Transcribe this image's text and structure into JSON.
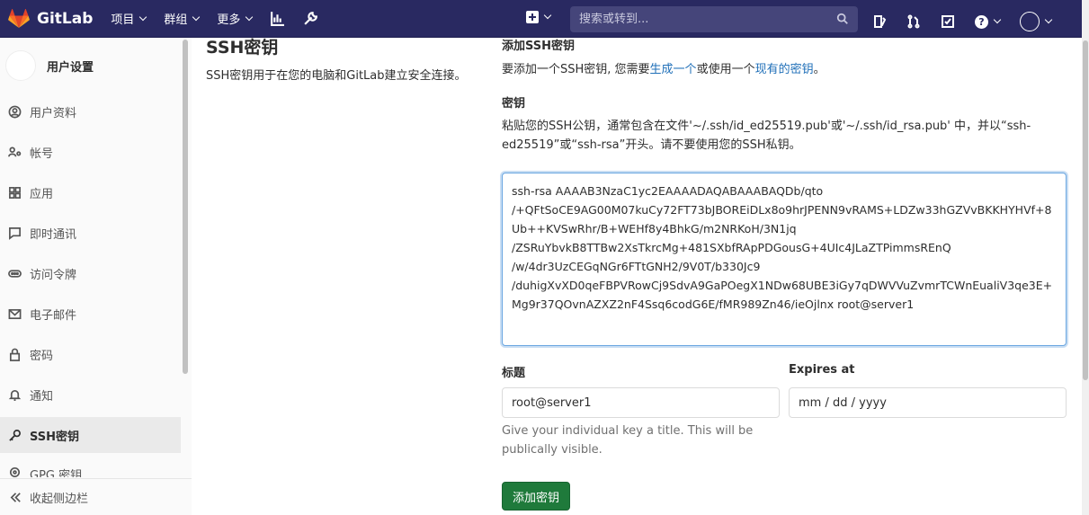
{
  "navbar": {
    "brand": "GitLab",
    "menus": [
      "项目",
      "群组",
      "更多"
    ],
    "search_placeholder": "搜索或转到..."
  },
  "sidebar": {
    "title": "用户设置",
    "items": [
      {
        "label": "用户资料",
        "icon": "user-icon"
      },
      {
        "label": "帐号",
        "icon": "account-icon"
      },
      {
        "label": "应用",
        "icon": "applications-icon"
      },
      {
        "label": "即时通讯",
        "icon": "chat-icon"
      },
      {
        "label": "访问令牌",
        "icon": "token-icon"
      },
      {
        "label": "电子邮件",
        "icon": "mail-icon"
      },
      {
        "label": "密码",
        "icon": "lock-icon"
      },
      {
        "label": "通知",
        "icon": "bell-icon"
      },
      {
        "label": "SSH密钥",
        "icon": "key-icon"
      },
      {
        "label": "GPG 密钥",
        "icon": "gpg-key-icon"
      }
    ],
    "collapse_label": "收起侧边栏"
  },
  "main": {
    "title": "SSH密钥",
    "description": "SSH密钥用于在您的电脑和GitLab建立安全连接。",
    "add_heading": "添加SSH密钥",
    "add_text_before": "要添加一个SSH密钥, 您需要",
    "add_link_generate": "生成一个",
    "add_text_middle": "或使用一个",
    "add_link_existing": "现有的密钥",
    "add_text_after": "。",
    "key_heading": "密钥",
    "key_instruction": "粘贴您的SSH公钥，通常包含在文件'~/.ssh/id_ed25519.pub'或'~/.ssh/id_rsa.pub' 中，并以“ssh-ed25519”或“ssh-rsa”开头。请不要使用您的SSH私钥。",
    "key_value": "ssh-rsa AAAAB3NzaC1yc2EAAAADAQABAAABAQDb/qto\n/+QFtSoCE9AG00M07kuCy72FT73bJBOREiDLx8o9hrJPENN9vRAMS+LDZw33hGZVvBKKHYHVf+8Ub++KVSwRhr/B+WEHf8y4BhkG/m2NRKoH/3N1jq\n/ZSRuYbvkB8TTBw2XsTkrcMg+481SXbfRApPDGousG+4UIc4JLaZTPimmsREnQ\n/w/4dr3UzCEGqNGr6FTtGNH2/9V0T/b330Jc9\n/duhigXvXD0qeFBPVRowCj9SdvA9GaPOegX1NDw68UBE3iGy7qDWVVuZvmrTCWnEualiV3qe3E+Mg9r37QOvnAZXZ2nF4Ssq6codG6E/fMR989Zn46/ieOjlnx root@server1\n",
    "title_label": "标题",
    "title_value": "root@server1",
    "expires_label": "Expires at",
    "expires_placeholder": "mm / dd / yyyy",
    "title_help": "Give your individual key a title. This will be publically visible.",
    "add_button": "添加密钥"
  }
}
